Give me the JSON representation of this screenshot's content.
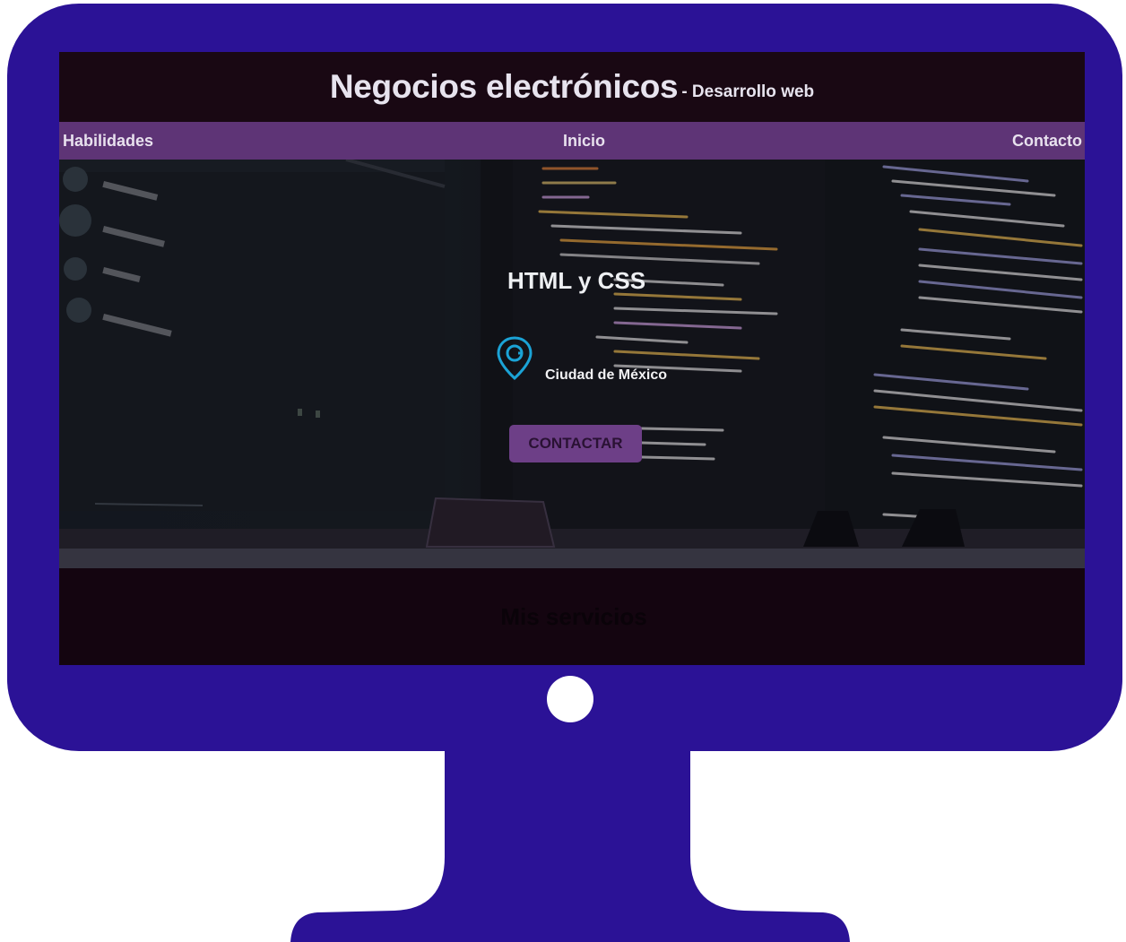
{
  "header": {
    "title": "Negocios electrónicos",
    "subtitle": "- Desarrollo web"
  },
  "nav": {
    "left": "Habilidades",
    "center": "Inicio",
    "right": "Contacto"
  },
  "hero": {
    "title": "HTML y CSS",
    "location": "Ciudad de México",
    "location_icon": "map-pin-icon",
    "cta_label": "CONTACTAR"
  },
  "services": {
    "title": "Mis servicios"
  },
  "colors": {
    "monitor": "#2b1296",
    "nav": "#5e3476",
    "button": "#6d3f87",
    "pin": "#1ba3d6"
  }
}
